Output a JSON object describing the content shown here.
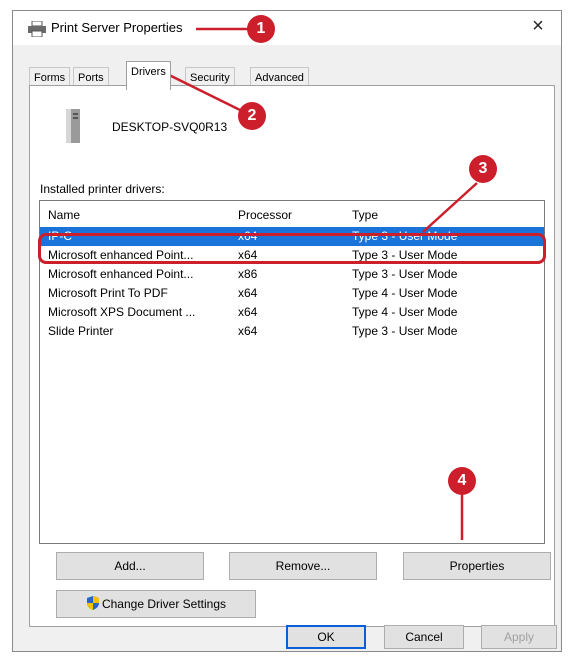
{
  "window": {
    "title": "Print Server Properties",
    "close_glyph": "×"
  },
  "tabs": [
    "Forms",
    "Ports",
    "Drivers",
    "Security",
    "Advanced"
  ],
  "active_tab": "Drivers",
  "server_name": "DESKTOP-SVQ0R13",
  "installed_label": "Installed printer drivers:",
  "columns": [
    "Name",
    "Processor",
    "Type"
  ],
  "drivers": [
    {
      "name": "IP-C",
      "processor": "x64",
      "type": "Type 3 - User Mode",
      "selected": true
    },
    {
      "name": "Microsoft enhanced Point...",
      "processor": "x64",
      "type": "Type 3 - User Mode"
    },
    {
      "name": "Microsoft enhanced Point...",
      "processor": "x86",
      "type": "Type 3 - User Mode"
    },
    {
      "name": "Microsoft Print To PDF",
      "processor": "x64",
      "type": "Type 4 - User Mode"
    },
    {
      "name": "Microsoft XPS Document ...",
      "processor": "x64",
      "type": "Type 4 - User Mode"
    },
    {
      "name": "Slide Printer",
      "processor": "x64",
      "type": "Type 3 - User Mode"
    }
  ],
  "buttons": {
    "add": "Add...",
    "remove": "Remove...",
    "properties": "Properties",
    "change_driver_settings": "Change Driver Settings",
    "ok": "OK",
    "cancel": "Cancel",
    "apply": "Apply"
  },
  "callouts": [
    "1",
    "2",
    "3",
    "4"
  ],
  "colors": {
    "selection": "#1a73d9",
    "callout": "#cc1f2b"
  },
  "icons": {
    "title": "printer-icon",
    "server": "computer-tower-icon",
    "uac": "uac-shield-icon"
  }
}
